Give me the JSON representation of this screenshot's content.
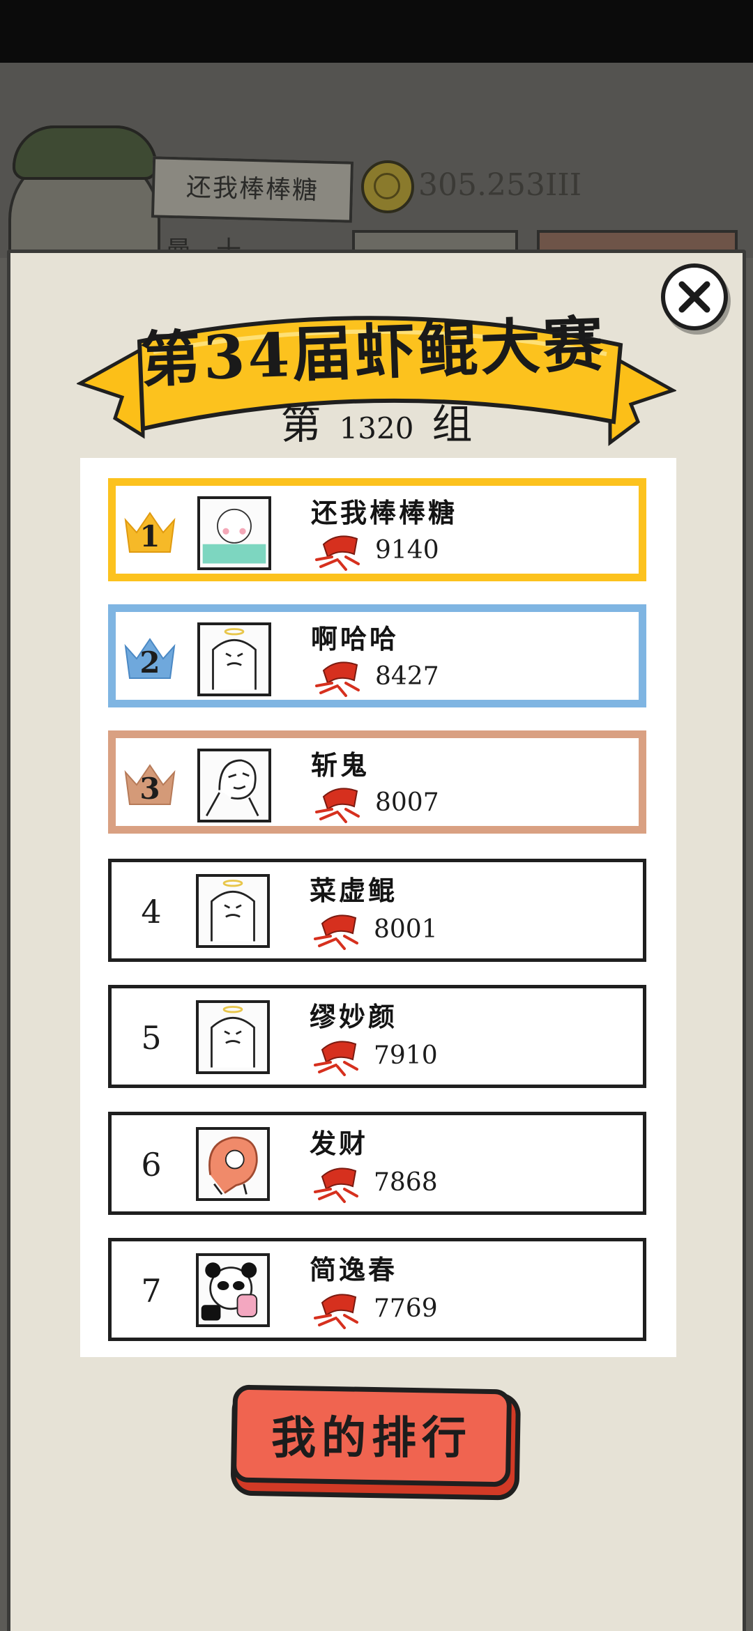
{
  "background": {
    "player_name": "还我棒棒糖",
    "coins": "305.253III",
    "subtitle": "曼…十…"
  },
  "banner": {
    "title": "第34届虾鲲大赛",
    "group_prefix": "第",
    "group_number": "1320",
    "group_suffix": "组"
  },
  "ranking": [
    {
      "rank": "1",
      "name": "还我棒棒糖",
      "score": "9140",
      "tier": "gold"
    },
    {
      "rank": "2",
      "name": "啊哈哈",
      "score": "8427",
      "tier": "silver"
    },
    {
      "rank": "3",
      "name": "斩鬼",
      "score": "8007",
      "tier": "bronze"
    },
    {
      "rank": "4",
      "name": "菜虚鲲",
      "score": "8001",
      "tier": "plain"
    },
    {
      "rank": "5",
      "name": "缪妙颜",
      "score": "7910",
      "tier": "plain"
    },
    {
      "rank": "6",
      "name": "发财",
      "score": "7868",
      "tier": "plain"
    },
    {
      "rank": "7",
      "name": "简逸春",
      "score": "7769",
      "tier": "plain"
    }
  ],
  "button": {
    "my_rank": "我的排行"
  },
  "icons": {
    "close": "close-icon",
    "crown": "crown-icon",
    "score": "shrimp-icon"
  },
  "colors": {
    "gold": "#fcc21e",
    "silver": "#7fb5e2",
    "bronze": "#d9a082",
    "button": "#f06450"
  }
}
